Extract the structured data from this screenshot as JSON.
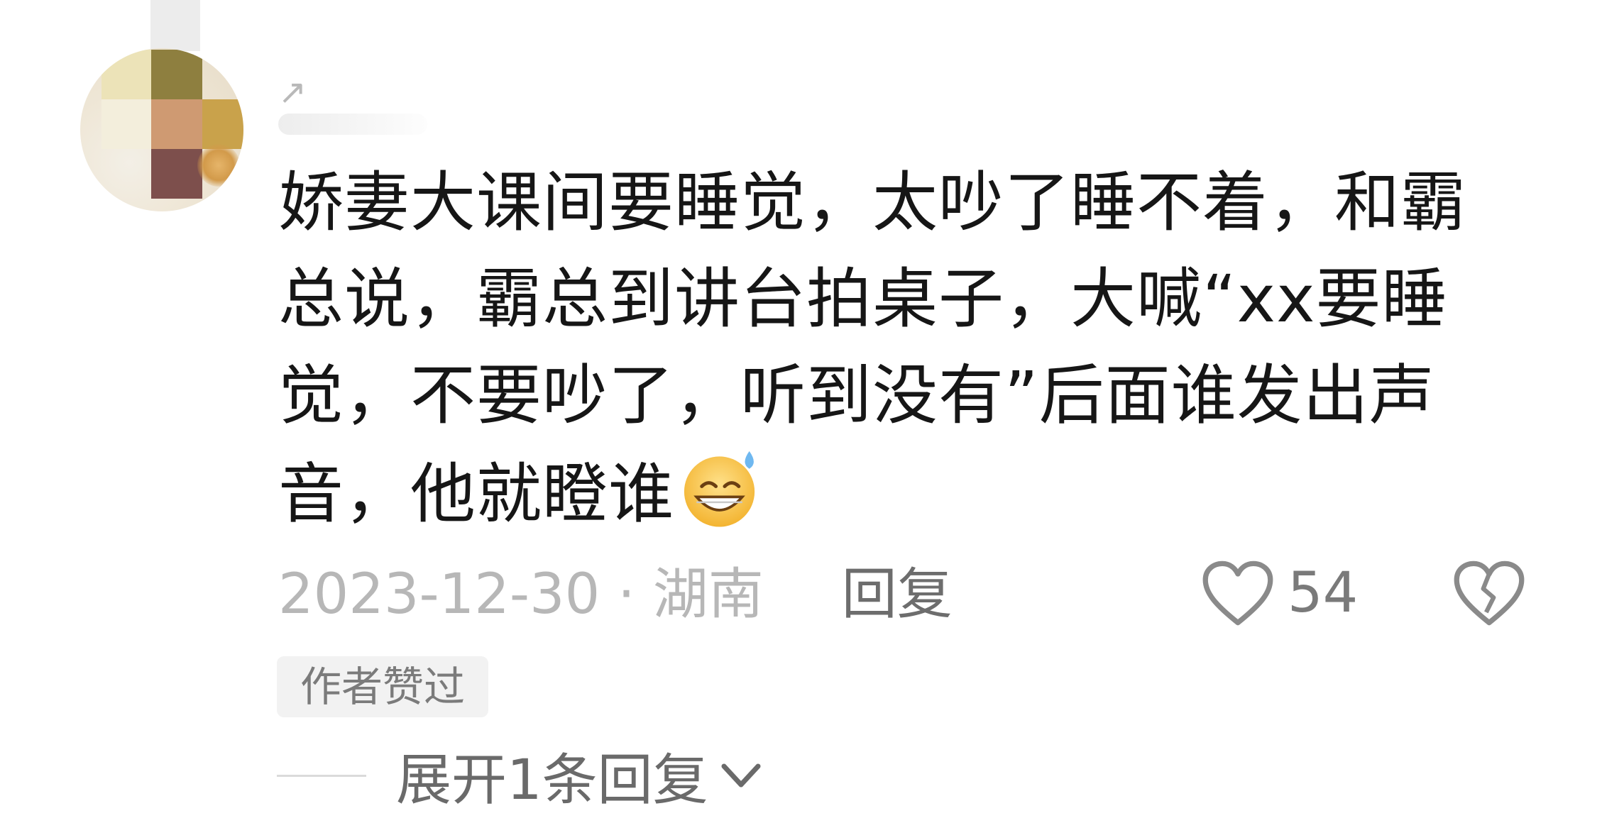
{
  "comment": {
    "username_prefix": "↗",
    "lines": [
      "娇妻大课间要睡觉，太吵了睡不着，和霸",
      "总说，霸总到讲台拍桌子，大喊“xx要睡",
      "觉，不要吵了，听到没有”后面谁发出声",
      "音，他就瞪谁"
    ],
    "emoji": "grinning-sweat-emoji",
    "date": "2023-12-30",
    "separator": " · ",
    "location": "湖南",
    "reply_label": "回复",
    "like_count": "54",
    "badge": "作者赞过",
    "expand_label": "展开1条回复"
  },
  "colors": {
    "text": "#161616",
    "meta": "#b7b7b7",
    "reply": "#6d6d6d",
    "icon": "#8a8a8a",
    "badge_bg": "#f2f2f2"
  }
}
